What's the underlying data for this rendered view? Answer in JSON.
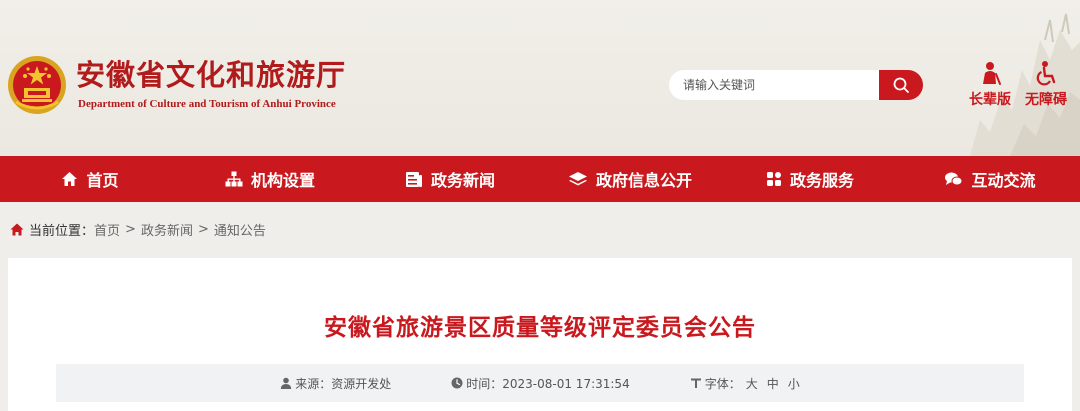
{
  "header": {
    "title": "安徽省文化和旅游厅",
    "subtitle": "Department of Culture and Tourism of Anhui Province",
    "search": {
      "placeholder": "请输入关键词"
    },
    "tools": [
      {
        "label": "长辈版",
        "icon": "elder-icon"
      },
      {
        "label": "无障碍",
        "icon": "wheelchair-icon"
      }
    ]
  },
  "nav": {
    "items": [
      {
        "label": "首页",
        "icon": "home-icon"
      },
      {
        "label": "机构设置",
        "icon": "org-chart-icon"
      },
      {
        "label": "政务新闻",
        "icon": "news-icon"
      },
      {
        "label": "政府信息公开",
        "icon": "layers-icon"
      },
      {
        "label": "政务服务",
        "icon": "grid-icon"
      },
      {
        "label": "互动交流",
        "icon": "chat-icon"
      }
    ]
  },
  "breadcrumb": {
    "label": "当前位置：",
    "items": [
      "首页",
      "政务新闻",
      "通知公告"
    ],
    "separator": ">"
  },
  "article": {
    "title": "安徽省旅游景区质量等级评定委员会公告",
    "meta": {
      "source": "来源：资源开发处",
      "time": "时间：2023-08-01 17:31:54",
      "font_label": "字体：",
      "sizes": [
        "大",
        "中",
        "小"
      ]
    }
  },
  "colors": {
    "brand_red": "#c9191e",
    "page_bg": "#efeeea"
  }
}
